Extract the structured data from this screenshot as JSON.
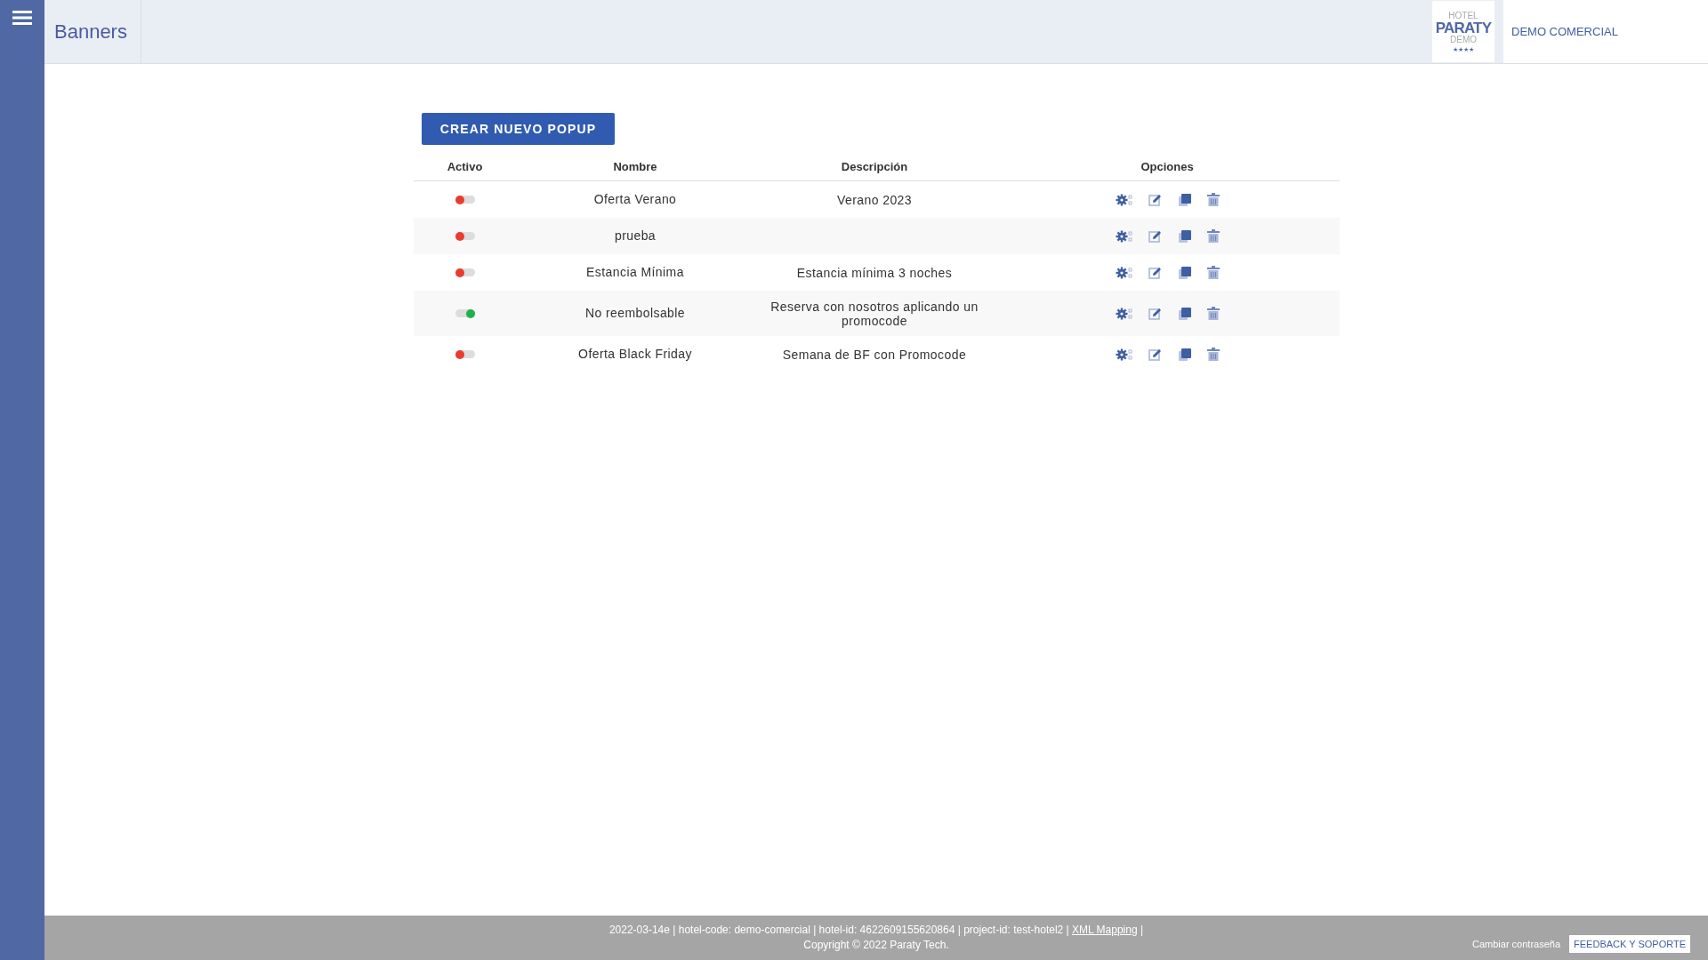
{
  "header": {
    "title": "Banners",
    "logo": {
      "line_1": "HOTEL",
      "line_2": "PARATY",
      "line_3": "DEMO",
      "stars": "★★★★"
    },
    "account": "DEMO COMERCIAL"
  },
  "create_button": "CREAR NUEVO POPUP",
  "table": {
    "columns": [
      "Activo",
      "Nombre",
      "Descripción",
      "Opciones"
    ],
    "rows": [
      {
        "on": false,
        "name": "Oferta Verano",
        "description": "Verano 2023"
      },
      {
        "on": false,
        "name": "prueba",
        "description": ""
      },
      {
        "on": false,
        "name": "Estancia Mínima",
        "description": "Estancia mínima 3 noches"
      },
      {
        "on": true,
        "name": "No reembolsable",
        "description": "Reserva con nosotros aplicando un promocode"
      },
      {
        "on": false,
        "name": "Oferta Black Friday",
        "description": "Semana de BF con Promocode"
      }
    ]
  },
  "footer": {
    "info_before": "2022-03-14e | hotel-code: demo-comercial | hotel-id: 4622609155620864 | project-id: test-hotel2 |",
    "link": "XML Mapping",
    "info_after": "|",
    "copyright": "Copyright © 2022 Paraty Tech.",
    "change_password": "Cambiar contraseña",
    "feedback_button": "FEEDBACK Y SOPORTE"
  }
}
